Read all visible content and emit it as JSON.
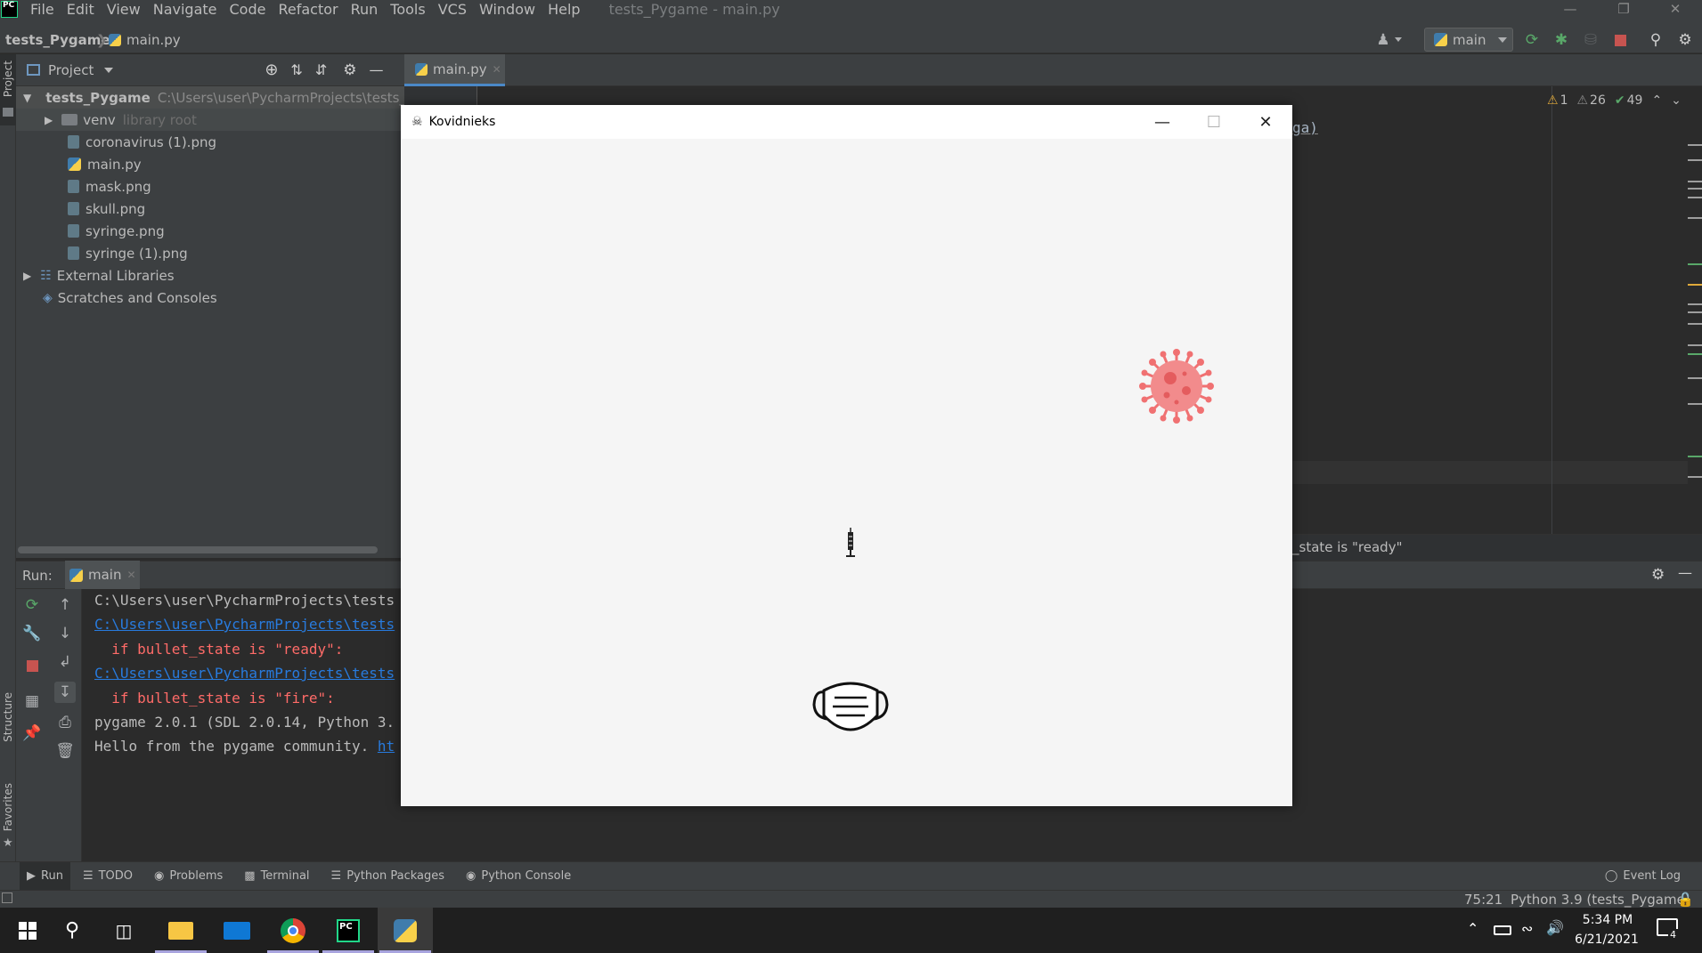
{
  "menubar": {
    "logo": "PC",
    "items": [
      "File",
      "Edit",
      "View",
      "Navigate",
      "Code",
      "Refactor",
      "Run",
      "Tools",
      "VCS",
      "Window",
      "Help"
    ],
    "window_title": "tests_Pygame - main.py"
  },
  "navbar": {
    "project": "tests_Pygame",
    "file": "main.py",
    "run_config": "main"
  },
  "left_stripe": {
    "project_label": "Project",
    "structure_label": "Structure",
    "favorites_label": "Favorites"
  },
  "project_panel": {
    "dropdown_label": "Project",
    "tree": [
      {
        "label": "tests_Pygame",
        "extra": "C:\\Users\\user\\PycharmProjects\\tests_Pyga",
        "type": "root"
      },
      {
        "label": "venv",
        "extra": "library root",
        "type": "folder"
      },
      {
        "label": "coronavirus (1).png",
        "type": "file"
      },
      {
        "label": "main.py",
        "type": "py"
      },
      {
        "label": "mask.png",
        "type": "file"
      },
      {
        "label": "skull.png",
        "type": "file"
      },
      {
        "label": "syringe.png",
        "type": "file"
      },
      {
        "label": "syringe (1).png",
        "type": "file"
      },
      {
        "label": "External Libraries",
        "type": "lib"
      },
      {
        "label": "Scratches and Consoles",
        "type": "scratch"
      }
    ]
  },
  "editor": {
    "tab_label": "main.py",
    "inspection": {
      "errors": "1",
      "warnings": "26",
      "ok": "49"
    },
    "code_fragment": "ga)",
    "breadcrumb_text": "_state is \"ready\""
  },
  "run_panel": {
    "label": "Run:",
    "tab": "main",
    "lines": [
      {
        "text": "C:\\Users\\user\\PycharmProjects\\tests",
        "style": "normal"
      },
      {
        "text": "C:\\Users\\user\\PycharmProjects\\tests",
        "style": "link"
      },
      {
        "text": "  if bullet_state is \"ready\":",
        "style": "red"
      },
      {
        "text": "C:\\Users\\user\\PycharmProjects\\tests",
        "style": "link"
      },
      {
        "text": "  if bullet_state is \"fire\":",
        "style": "red"
      },
      {
        "text": "pygame 2.0.1 (SDL 2.0.14, Python 3.",
        "style": "normal"
      },
      {
        "text": "Hello from the pygame community. ",
        "style": "normal",
        "link_tail": "ht"
      }
    ]
  },
  "bottom_tabs": [
    "Run",
    "TODO",
    "Problems",
    "Terminal",
    "Python Packages",
    "Python Console"
  ],
  "event_log": "Event Log",
  "status": {
    "position": "75:21",
    "interpreter": "Python 3.9 (tests_Pygame)"
  },
  "pygame_window": {
    "title": "Kovidnieks"
  },
  "taskbar": {
    "time": "5:34 PM",
    "date": "6/21/2021",
    "notifications": "4"
  }
}
